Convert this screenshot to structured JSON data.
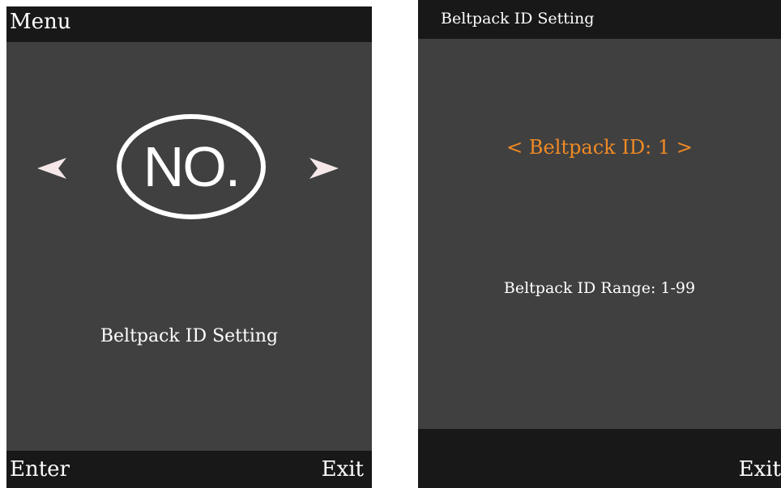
{
  "menu_screen": {
    "title": "Menu",
    "icon": {
      "name": "number-icon",
      "text": "NO."
    },
    "item_label": "Beltpack ID Setting",
    "softkeys": {
      "left": "Enter",
      "right": "Exit"
    }
  },
  "id_setting_screen": {
    "title": "Beltpack ID Setting",
    "id_field": {
      "prev_glyph": "<",
      "label": "Beltpack ID:",
      "value": "1",
      "next_glyph": ">"
    },
    "range_text": "Beltpack ID Range: 1-99",
    "softkeys": {
      "right": "Exit"
    }
  },
  "colors": {
    "screen_bg": "#404040",
    "bar_bg": "#181818",
    "text": "#ffffff",
    "accent": "#f08a24"
  }
}
